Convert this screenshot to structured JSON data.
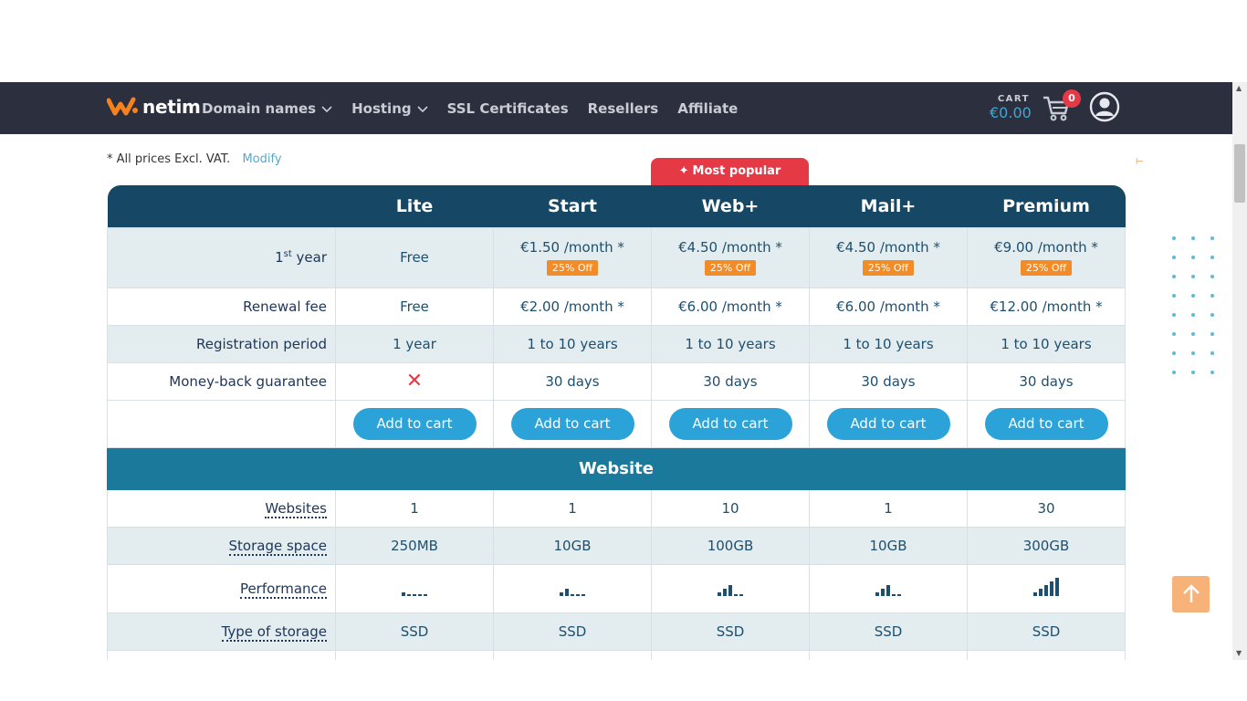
{
  "nav": {
    "logo_text": "netim",
    "items": [
      {
        "label": "Domain names",
        "has_dropdown": true
      },
      {
        "label": "Hosting",
        "has_dropdown": true
      },
      {
        "label": "SSL Certificates",
        "has_dropdown": false
      },
      {
        "label": "Resellers",
        "has_dropdown": false
      },
      {
        "label": "Affiliate",
        "has_dropdown": false
      }
    ],
    "cart_label": "CART",
    "cart_amount": "€0.00",
    "cart_count": "0"
  },
  "vat_note": "* All prices Excl. VAT.",
  "modify_link": "Modify",
  "most_popular": "Most popular",
  "plans": [
    "Lite",
    "Start",
    "Web+",
    "Mail+",
    "Premium"
  ],
  "rows": {
    "first_year": {
      "label_main": "1",
      "label_sup": "st",
      "label_rest": " year",
      "values": [
        {
          "price": "Free",
          "off": ""
        },
        {
          "price": "€1.50 /month *",
          "off": "25% Off"
        },
        {
          "price": "€4.50 /month *",
          "off": "25% Off"
        },
        {
          "price": "€4.50 /month *",
          "off": "25% Off"
        },
        {
          "price": "€9.00 /month *",
          "off": "25% Off"
        }
      ]
    },
    "renewal": {
      "label": "Renewal fee",
      "values": [
        "Free",
        "€2.00 /month *",
        "€6.00 /month *",
        "€6.00 /month *",
        "€12.00 /month *"
      ]
    },
    "registration": {
      "label": "Registration period",
      "values": [
        "1 year",
        "1 to 10 years",
        "1 to 10 years",
        "1 to 10 years",
        "1 to 10 years"
      ]
    },
    "money_back": {
      "label": "Money-back guarantee",
      "values": [
        "✕",
        "30 days",
        "30 days",
        "30 days",
        "30 days"
      ]
    },
    "add_to_cart": "Add to cart"
  },
  "section_website": "Website",
  "website_rows": {
    "websites": {
      "label": "Websites",
      "values": [
        "1",
        "1",
        "10",
        "1",
        "30"
      ]
    },
    "storage": {
      "label": "Storage space",
      "values": [
        "250MB",
        "10GB",
        "100GB",
        "10GB",
        "300GB"
      ]
    },
    "performance": {
      "label": "Performance",
      "levels": [
        1,
        2,
        3,
        3,
        5
      ],
      "max_level": 5
    },
    "storage_type": {
      "label": "Type of storage",
      "values": [
        "SSD",
        "SSD",
        "SSD",
        "SSD",
        "SSD"
      ]
    }
  },
  "colors": {
    "navbar": "#2b2f3e",
    "table_header": "#164866",
    "section_header": "#1b7a9c",
    "button": "#2ba3d9",
    "discount": "#f28c28",
    "popular": "#e63946"
  }
}
